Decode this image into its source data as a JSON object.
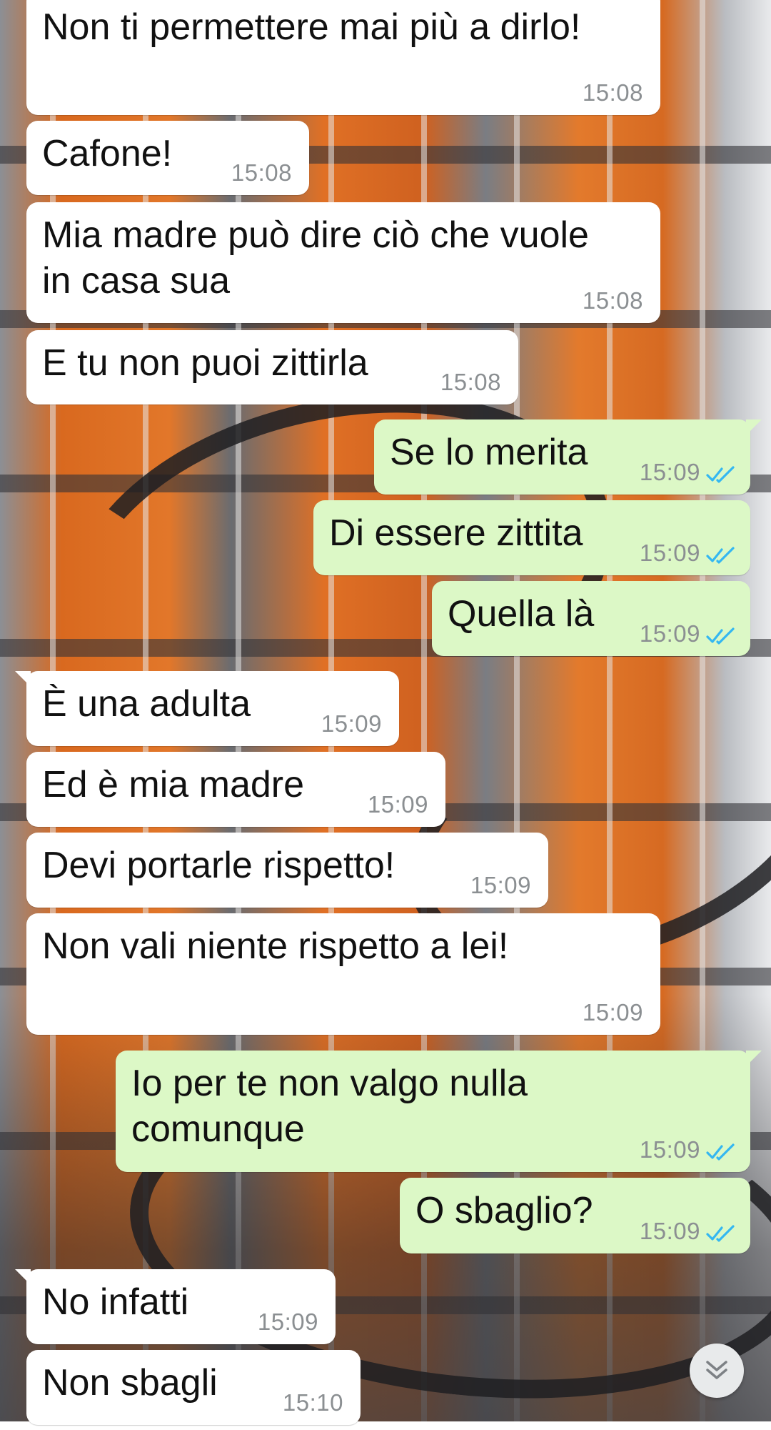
{
  "chat": {
    "messages": [
      {
        "dir": "in",
        "text": "Non ti permettere mai più a dirlo!",
        "time": "15:08"
      },
      {
        "dir": "in",
        "text": "Cafone!",
        "time": "15:08"
      },
      {
        "dir": "in",
        "text": "Mia madre può dire ciò che vuole\nin casa sua",
        "time": "15:08"
      },
      {
        "dir": "in",
        "text": "E tu non puoi zittirla",
        "time": "15:08"
      },
      {
        "dir": "out",
        "text": "Se lo merita",
        "time": "15:09",
        "status": "read"
      },
      {
        "dir": "out",
        "text": "Di essere zittita",
        "time": "15:09",
        "status": "read"
      },
      {
        "dir": "out",
        "text": "Quella là",
        "time": "15:09",
        "status": "read"
      },
      {
        "dir": "in",
        "text": "È una adulta",
        "time": "15:09"
      },
      {
        "dir": "in",
        "text": "Ed è mia madre",
        "time": "15:09"
      },
      {
        "dir": "in",
        "text": "Devi portarle rispetto!",
        "time": "15:09"
      },
      {
        "dir": "in",
        "text": "Non vali niente rispetto a lei!",
        "time": "15:09"
      },
      {
        "dir": "out",
        "text": "Io per te non valgo nulla\ncomunque",
        "time": "15:09",
        "status": "read"
      },
      {
        "dir": "out",
        "text": "O sbaglio?",
        "time": "15:09",
        "status": "read"
      },
      {
        "dir": "in",
        "text": "No infatti",
        "time": "15:09"
      },
      {
        "dir": "in",
        "text": "Non sbagli",
        "time": "15:10"
      }
    ]
  },
  "icons": {
    "read_receipt": "double-check-icon",
    "scroll_down": "chevron-double-down-icon"
  },
  "colors": {
    "incoming_bubble": "#ffffff",
    "outgoing_bubble": "#dcf8c6",
    "read_tick": "#34b7f1",
    "timestamp": "#8b8f92"
  }
}
